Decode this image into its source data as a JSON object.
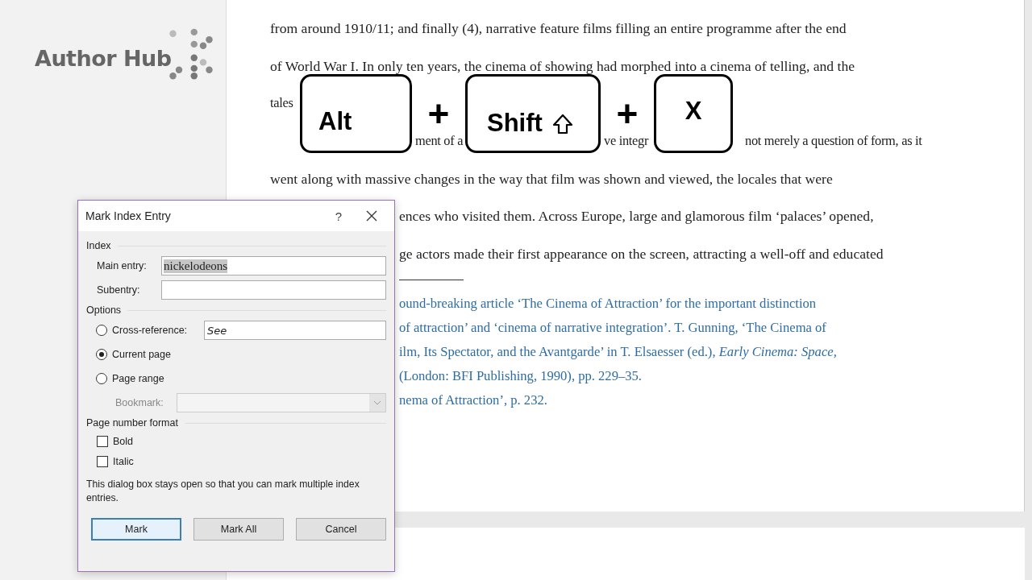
{
  "sidebar": {
    "logo": "Author Hub"
  },
  "document": {
    "lines": [
      "from around 1910/11; and finally (4), narrative feature films filling an entire programme after the end",
      "of World War I. In only ten years, the cinema of showing had morphed into a cinema of telling, and the",
      [
        "tales"
      ],
      [
        "ment of a",
        "ve integr",
        "not merely a question of form, as it"
      ],
      "went along with massive changes in the way that film was shown and viewed, the locales that were"
    ],
    "partial_lines": [
      "ences who visited them. Across Europe, large and glamorous film ‘palaces’ opened,",
      "ge actors made their first appearance on the screen, attracting a well-off and educated"
    ],
    "footnotes": [
      "ound-breaking article ‘The Cinema of Attraction’ for the important distinction",
      "of attraction’ and ‘cinema of narrative integration’. T. Gunning, ‘The Cinema of",
      "ilm, Its Spectator, and the Avantgarde’ in T. Elsaesser (ed.), *Early Cinema: Space,*",
      "(London: BFI Publishing, 1990), pp. 229–35.",
      "nema of Attraction’, p. 232."
    ]
  },
  "shortcut": {
    "keys": [
      {
        "label": "Alt",
        "kind": "plain"
      },
      {
        "label": "Shift",
        "kind": "shift"
      },
      {
        "label": "X",
        "kind": "letter"
      }
    ],
    "separators": [
      "+",
      "+"
    ]
  },
  "dialog": {
    "title": "Mark Index Entry",
    "help": "?",
    "index_section": "Index",
    "fields": [
      {
        "label": "Main entry:",
        "value": "nickelodeons",
        "text_selected": true
      },
      {
        "label": "Subentry:"
      }
    ],
    "options_section": "Options",
    "radios": [
      {
        "label": "Cross-reference:",
        "selected": false,
        "field_value": "See"
      },
      {
        "label": "Current page",
        "selected": true
      },
      {
        "label": "Page range",
        "selected": false
      }
    ],
    "bookmark": {
      "label": "Bookmark:",
      "disabled": true
    },
    "format_section": "Page number format",
    "checkboxes": [
      {
        "label": "Bold",
        "checked": false
      },
      {
        "label": "Italic",
        "checked": false
      }
    ],
    "note": "This dialog box stays open so that you can mark multiple index entries.",
    "buttons": [
      {
        "label": "Mark",
        "default": true
      },
      {
        "label": "Mark All",
        "default": false
      },
      {
        "label": "Cancel",
        "default": false
      }
    ]
  }
}
